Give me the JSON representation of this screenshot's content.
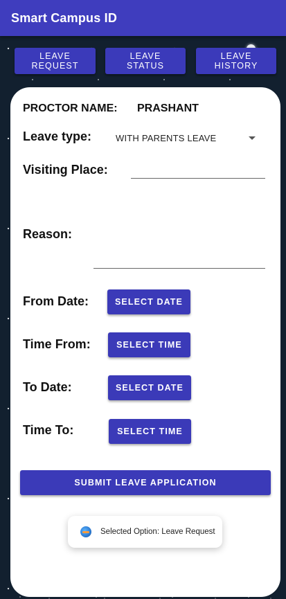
{
  "app": {
    "title": "Smart Campus ID"
  },
  "top_nav": [
    {
      "line1": "LEAVE",
      "line2": "REQUEST"
    },
    {
      "line1": "LEAVE",
      "line2": "STATUS"
    },
    {
      "line1": "LEAVE",
      "line2": "HISTORY"
    }
  ],
  "form": {
    "proctor_label": "PROCTOR NAME:",
    "proctor_value": "PRASHANT",
    "leave_type_label": "Leave type:",
    "leave_type_value": "WITH PARENTS LEAVE",
    "visiting_place_label": "Visiting Place:",
    "visiting_place_value": "",
    "reason_label": "Reason:",
    "reason_value": "",
    "from_date_label": "From Date:",
    "from_date_button": "SELECT DATE",
    "time_from_label": "Time From:",
    "time_from_button": "SELECT TIME",
    "to_date_label": "To Date:",
    "to_date_button": "SELECT DATE",
    "time_to_label": "Time To:",
    "time_to_button": "SELECT TIME",
    "submit_label": "SUBMIT LEAVE APPLICATION"
  },
  "toast": {
    "icon": "app-icon",
    "text": "Selected Option: Leave Request"
  },
  "colors": {
    "primary": "#3f3dbe",
    "button": "#3b3ab8",
    "background": "#12202f",
    "card": "#ffffff"
  }
}
